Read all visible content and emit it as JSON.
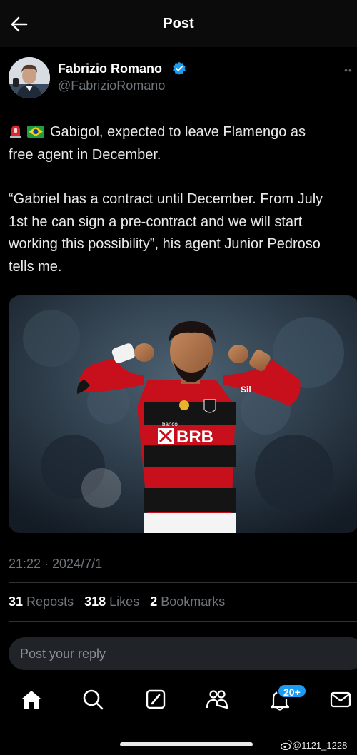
{
  "header": {
    "title": "Post"
  },
  "author": {
    "name": "Fabrizio Romano",
    "handle": "@FabrizioRomano"
  },
  "tweet": {
    "line1": "Gabigol, expected to leave Flamengo as",
    "line2": "free agent in December.",
    "line3": "“Gabriel has a contract until December. From July",
    "line4": "1st he can sign a pre-contract and we will start",
    "line5": "working this possibility”, his agent Junior Pedroso",
    "line6": "tells me.",
    "emoji1": "siren-icon",
    "emoji2": "brazil-flag-icon"
  },
  "media": {
    "jersey_sponsor": "BRB",
    "jersey_sponsor_small": "banco",
    "sleeve_sponsor": "Sil"
  },
  "meta": {
    "timestamp": "21:22 · 2024/7/1"
  },
  "stats": {
    "reposts_count": "31",
    "reposts_label": "Reposts",
    "likes_count": "318",
    "likes_label": "Likes",
    "bookmarks_count": "2",
    "bookmarks_label": "Bookmarks"
  },
  "reply": {
    "placeholder": "Post your reply"
  },
  "nav": {
    "items": [
      "home-icon",
      "search-icon",
      "grok-icon",
      "communities-icon",
      "notifications-icon",
      "messages-icon"
    ],
    "notifications_badge": "20+"
  },
  "watermark": {
    "text": "@1121_1228"
  },
  "colors": {
    "accent": "#1d9bf0",
    "background": "#000000",
    "muted": "#71767b",
    "jersey_red": "#d0101c"
  }
}
